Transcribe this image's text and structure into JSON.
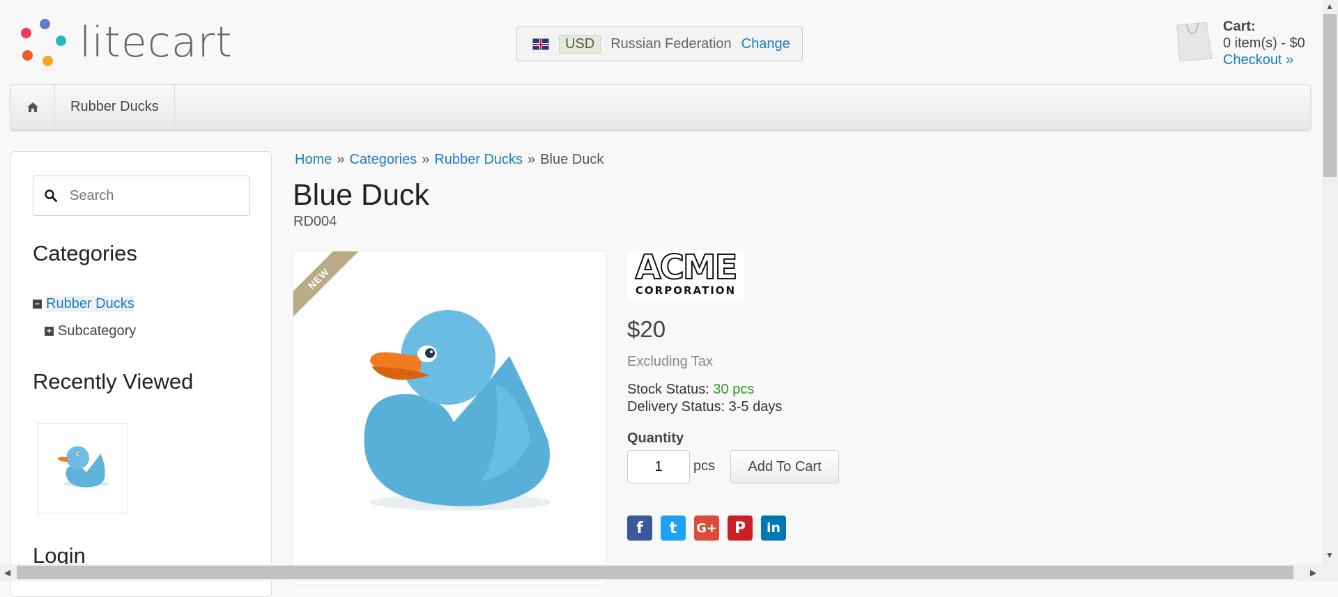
{
  "header": {
    "logo_text": "litecart",
    "logo_colors": [
      "#e73c5a",
      "#5a7ec9",
      "#25b7c3",
      "#f05a28",
      "#f6a623"
    ],
    "region": {
      "currency": "USD",
      "country": "Russian Federation",
      "change_label": "Change"
    },
    "cart": {
      "title": "Cart:",
      "summary": "0 item(s) - $0",
      "checkout_label": "Checkout »"
    }
  },
  "navbar": {
    "items": [
      "Rubber Ducks"
    ]
  },
  "sidebar": {
    "search_placeholder": "Search",
    "categories_heading": "Categories",
    "categories": [
      {
        "label": "Rubber Ducks",
        "expanded": true
      },
      {
        "label": "Subcategory",
        "expanded": false
      }
    ],
    "recently_viewed_heading": "Recently Viewed",
    "login_heading": "Login"
  },
  "breadcrumb": [
    "Home",
    "Categories",
    "Rubber Ducks",
    "Blue Duck"
  ],
  "product": {
    "name": "Blue Duck",
    "sku": "RD004",
    "badge": "NEW",
    "manufacturer": "ACME",
    "manufacturer_sub": "CORPORATION",
    "price": "$20",
    "tax_note": "Excluding Tax",
    "stock_label": "Stock Status:",
    "stock_value": "30 pcs",
    "delivery_label": "Delivery Status:",
    "delivery_value": "3-5 days",
    "quantity_label": "Quantity",
    "quantity_value": "1",
    "unit": "pcs",
    "add_to_cart_label": "Add To Cart"
  },
  "social": [
    {
      "name": "facebook",
      "glyph": "f",
      "color": "#3b5998"
    },
    {
      "name": "twitter",
      "glyph": "t",
      "color": "#1da1f2"
    },
    {
      "name": "google-plus",
      "glyph": "G+",
      "color": "#dd4b39"
    },
    {
      "name": "pinterest",
      "glyph": "P",
      "color": "#cb2027"
    },
    {
      "name": "linkedin",
      "glyph": "in",
      "color": "#0077b5"
    }
  ]
}
